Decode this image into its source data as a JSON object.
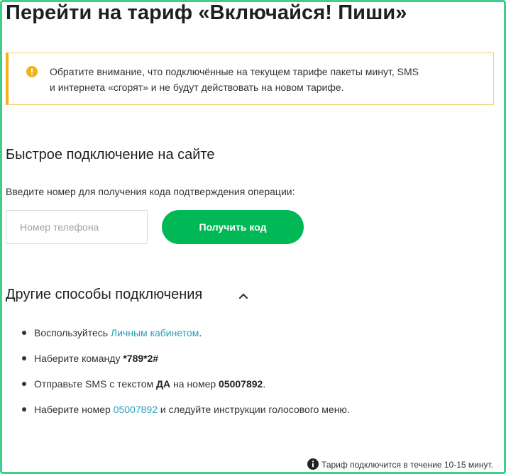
{
  "page": {
    "title": "Перейти на тариф «Включайся! Пиши»"
  },
  "notice": {
    "icon": "warning-info-icon",
    "icon_color": "#f0b31a",
    "line1": "Обратите внимание, что подключённые на текущем тарифе пакеты минут, SMS",
    "line2": "и интернета «сгорят» и не будут действовать на новом тарифе."
  },
  "quick_connect": {
    "title": "Быстрое подключение на сайте",
    "prompt": "Введите номер для получения кода подтверждения операции:",
    "phone_placeholder": "Номер телефона",
    "phone_value": "",
    "button_label": "Получить код",
    "button_color": "#00b956"
  },
  "other_methods": {
    "title": "Другие способы подключения",
    "toggle_icon": "chevron-up-icon",
    "items": [
      {
        "prefix": "Воспользуйтесь ",
        "link": "Личным кабинетом",
        "suffix": "."
      },
      {
        "prefix": "Наберите команду ",
        "bold": "*789*2#"
      },
      {
        "prefix": "Отправьте SMS с текстом ",
        "bold1": "ДА",
        "middle": " на номер ",
        "bold2": "05007892",
        "suffix": "."
      },
      {
        "prefix": "Наберите номер ",
        "link": "05007892",
        "suffix": " и следуйте инструкции голосового меню."
      }
    ],
    "link_color": "#299fb8"
  },
  "footnote": {
    "icon": "info-icon",
    "text": "Тариф подключится в течение 10-15 минут."
  },
  "frame_color": "#3ed08a"
}
